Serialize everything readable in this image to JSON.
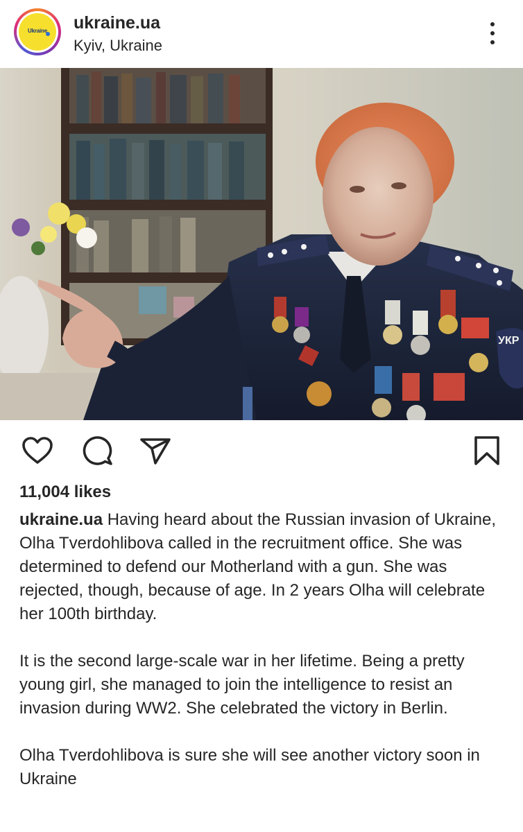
{
  "post": {
    "username": "ukraine.ua",
    "location": "Kyiv, Ukraine",
    "avatar_text": "Ukraine",
    "likes": "11,004 likes"
  },
  "caption": {
    "username": "ukraine.ua",
    "paragraph1_text": " Having heard about the Russian invasion of Ukraine, Olha Tverdohlibova called in the recruitment office. She was determined to defend our Motherland with a gun. She was rejected, though, because of age. In 2 years Olha will celebrate her 100th birthday.",
    "paragraph2": "It is the second large-scale war in her lifetime. Being a pretty young girl, she managed to join the intelligence to resist an invasion during WW2. She celebrated the victory in Berlin.",
    "paragraph3": "Olha Tverdohlibova is sure she will see another victory soon in Ukraine"
  },
  "icons": {
    "more": "more-options-icon",
    "like": "heart-icon",
    "comment": "comment-icon",
    "share": "send-icon",
    "save": "bookmark-icon",
    "flag": "ukraine-flag-emoji"
  },
  "colors": {
    "text": "#262626",
    "flag_blue": "#1a62c6",
    "flag_yellow": "#f5cf1a",
    "avatar_yellow": "#f7df2e"
  }
}
